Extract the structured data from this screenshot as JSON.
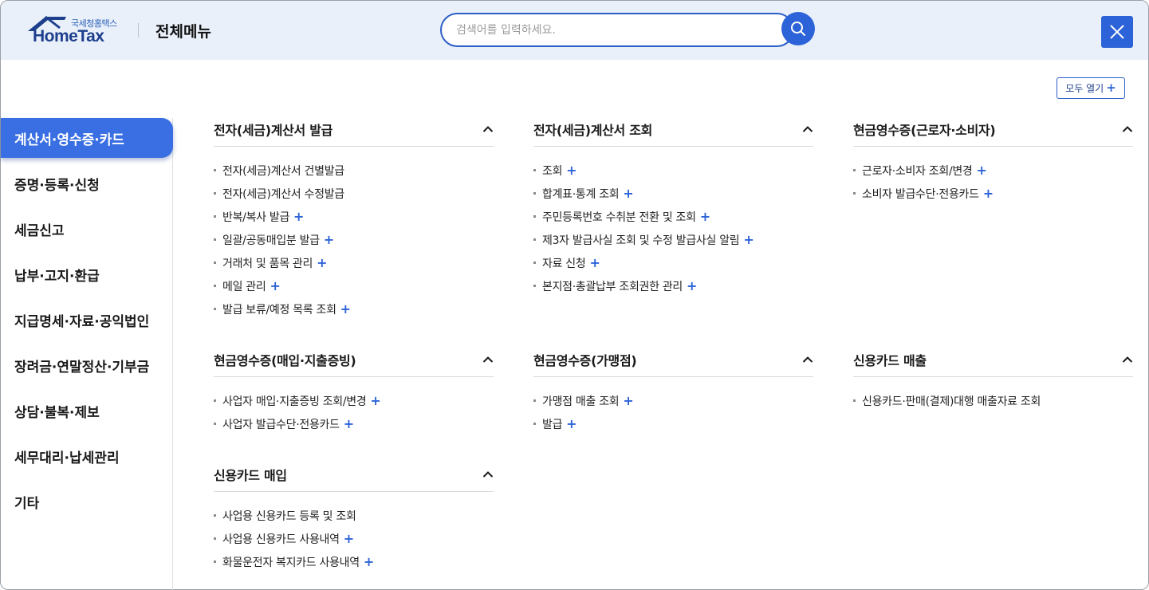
{
  "header": {
    "logo_sub": "국세청홈택스",
    "logo_main": "HomeTax",
    "title": "전체메뉴",
    "search_placeholder": "검색어를 입력하세요."
  },
  "expand_all_label": "모두 열기",
  "colors": {
    "accent": "#2d63d8",
    "header_bg": "#e9f0fa",
    "active_tab": "#3a6fe3"
  },
  "sidebar": {
    "items": [
      {
        "label": "계산서·영수증·카드",
        "active": true
      },
      {
        "label": "증명·등록·신청",
        "active": false
      },
      {
        "label": "세금신고",
        "active": false
      },
      {
        "label": "납부·고지·환급",
        "active": false
      },
      {
        "label": "지급명세·자료·공익법인",
        "active": false
      },
      {
        "label": "장려금·연말정산·기부금",
        "active": false
      },
      {
        "label": "상담·불복·제보",
        "active": false
      },
      {
        "label": "세무대리·납세관리",
        "active": false
      },
      {
        "label": "기타",
        "active": false
      }
    ]
  },
  "sections": [
    {
      "title": "전자(세금)계산서 발급",
      "items": [
        {
          "label": "전자(세금)계산서 건별발급",
          "plus": false
        },
        {
          "label": "전자(세금)계산서 수정발급",
          "plus": false
        },
        {
          "label": "반복/복사 발급",
          "plus": true
        },
        {
          "label": "일괄/공동매입분 발급",
          "plus": true
        },
        {
          "label": "거래처 및 품목 관리",
          "plus": true
        },
        {
          "label": "메일 관리",
          "plus": true
        },
        {
          "label": "발급 보류/예정 목록 조회",
          "plus": true
        }
      ]
    },
    {
      "title": "전자(세금)계산서 조회",
      "items": [
        {
          "label": "조회",
          "plus": true
        },
        {
          "label": "합계표·통계 조회",
          "plus": true
        },
        {
          "label": "주민등록번호 수취분 전환 및 조회",
          "plus": true
        },
        {
          "label": "제3자 발급사실 조회 및 수정 발급사실 알림",
          "plus": true
        },
        {
          "label": "자료 신청",
          "plus": true
        },
        {
          "label": "본지점·총괄납부 조회권한 관리",
          "plus": true
        }
      ]
    },
    {
      "title": "현금영수증(근로자·소비자)",
      "items": [
        {
          "label": "근로자·소비자 조회/변경",
          "plus": true
        },
        {
          "label": "소비자 발급수단·전용카드",
          "plus": true
        }
      ]
    },
    {
      "title": "현금영수증(매입·지출증빙)",
      "items": [
        {
          "label": "사업자 매입·지출증빙 조회/변경",
          "plus": true
        },
        {
          "label": "사업자 발급수단·전용카드",
          "plus": true
        }
      ]
    },
    {
      "title": "현금영수증(가맹점)",
      "items": [
        {
          "label": "가맹점 매출 조회",
          "plus": true
        },
        {
          "label": "발급",
          "plus": true
        }
      ]
    },
    {
      "title": "신용카드 매출",
      "items": [
        {
          "label": "신용카드·판매(결제)대행 매출자료 조회",
          "plus": false
        }
      ]
    },
    {
      "title": "신용카드 매입",
      "items": [
        {
          "label": "사업용 신용카드 등록 및 조회",
          "plus": false
        },
        {
          "label": "사업용 신용카드 사용내역",
          "plus": true
        },
        {
          "label": "화물운전자 복지카드 사용내역",
          "plus": true
        }
      ]
    }
  ]
}
